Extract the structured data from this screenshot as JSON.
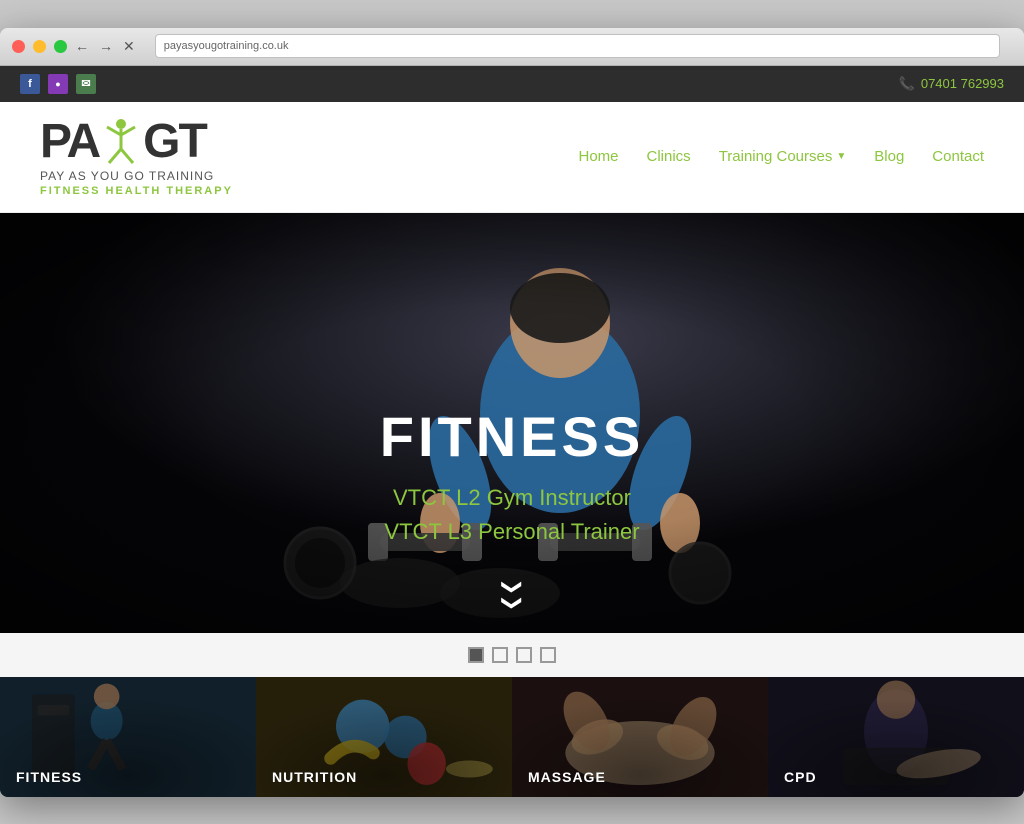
{
  "browser": {
    "address": "payasyougotraining.co.uk",
    "btn_red": "",
    "btn_yellow": "",
    "btn_green": ""
  },
  "topbar": {
    "phone": "07401 762993",
    "social": [
      "f",
      "in",
      "✉"
    ]
  },
  "header": {
    "logo_pa": "PA",
    "logo_gt": "GT",
    "logo_sub": "PAY AS YOU GO TRAINING",
    "logo_tagline": "FITNESS HEALTH THERAPY"
  },
  "nav": {
    "items": [
      {
        "label": "Home",
        "has_dropdown": false
      },
      {
        "label": "Clinics",
        "has_dropdown": false
      },
      {
        "label": "Training Courses",
        "has_dropdown": true
      },
      {
        "label": "Blog",
        "has_dropdown": false
      },
      {
        "label": "Contact",
        "has_dropdown": false
      }
    ]
  },
  "hero": {
    "title": "FITNESS",
    "subtitle1": "VTCT L2 Gym Instructor",
    "subtitle2": "VTCT L3 Personal Trainer"
  },
  "slider": {
    "dots": [
      {
        "active": true
      },
      {
        "active": false
      },
      {
        "active": false
      },
      {
        "active": false
      }
    ]
  },
  "tiles": [
    {
      "label": "FITNESS",
      "key": "fitness"
    },
    {
      "label": "NUTRITION",
      "key": "nutrition"
    },
    {
      "label": "MASSAGE",
      "key": "massage"
    },
    {
      "label": "CPD",
      "key": "cpd"
    }
  ]
}
